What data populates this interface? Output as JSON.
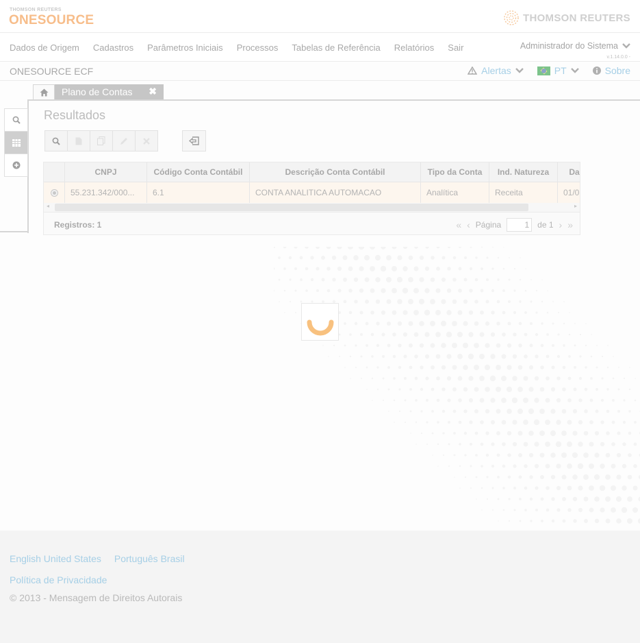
{
  "header": {
    "brand_small": "THOMSON REUTERS",
    "brand_name": "ONESOURCE",
    "partner_logo": "THOMSON REUTERS",
    "accent_color": "#f7bd8a"
  },
  "nav": {
    "items": [
      {
        "label": "Dados de Origem"
      },
      {
        "label": "Cadastros"
      },
      {
        "label": "Parâmetros Iniciais"
      },
      {
        "label": "Processos"
      },
      {
        "label": "Tabelas de Referência"
      },
      {
        "label": "Relatórios"
      },
      {
        "label": "Sair"
      }
    ],
    "user": "Administrador do Sistema",
    "version": "v.1.14.0.0 -"
  },
  "subbar": {
    "app_title": "ONESOURCE ECF",
    "alerts_label": "Alertas",
    "language_label": "PT",
    "about_label": "Sobre",
    "link_color": "#a6cfe6"
  },
  "tabs": {
    "home_icon": "home-icon",
    "active_label": "Plano de Contas"
  },
  "side_buttons": [
    {
      "icon": "search-icon"
    },
    {
      "icon": "table-icon"
    },
    {
      "icon": "plus-circle-icon"
    }
  ],
  "results": {
    "title": "Resultados"
  },
  "toolbar": {
    "buttons": [
      "search-icon",
      "new-doc-icon",
      "copy-icon",
      "edit-icon",
      "delete-icon",
      "export-icon"
    ]
  },
  "grid": {
    "columns": [
      "",
      "CNPJ",
      "Código Conta Contábil",
      "Descrição Conta Contábil",
      "Tipo da Conta",
      "Ind. Natureza",
      "Da"
    ],
    "rows": [
      {
        "cnpj": "55.231.342/000...",
        "codigo": "6.1",
        "descricao": "CONTA ANALITICA AUTOMACAO",
        "tipo": "Analítica",
        "natureza": "Receita",
        "data": "01/0"
      }
    ],
    "records_label": "Registros: 1",
    "page_label": "Página",
    "page_value": "1",
    "page_of": "de 1"
  },
  "footer": {
    "lang_en": "English United States",
    "lang_pt": "Português Brasil",
    "privacy": "Política de Privacidade",
    "copyright": "© 2013 - Mensagem de Direitos Autorais"
  }
}
